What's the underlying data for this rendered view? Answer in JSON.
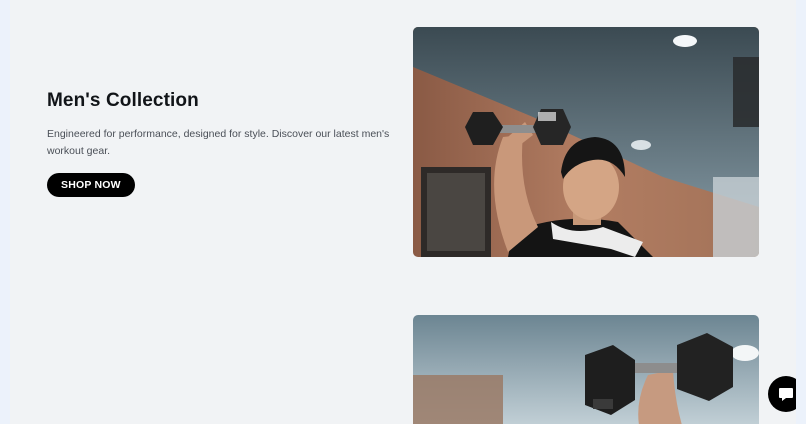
{
  "collection": {
    "title": "Men's Collection",
    "description": "Engineered for performance, designed for style. Discover our latest men's workout gear.",
    "button_label": "SHOP NOW"
  },
  "images": {
    "hero": "man-lifting-dumbbell-photo",
    "secondary": "dumbbell-overhead-photo"
  },
  "chat": {
    "icon": "chat-bubble-icon"
  },
  "colors": {
    "button_bg": "#000000",
    "button_text": "#ffffff",
    "page_bg": "#f1f3f5"
  }
}
